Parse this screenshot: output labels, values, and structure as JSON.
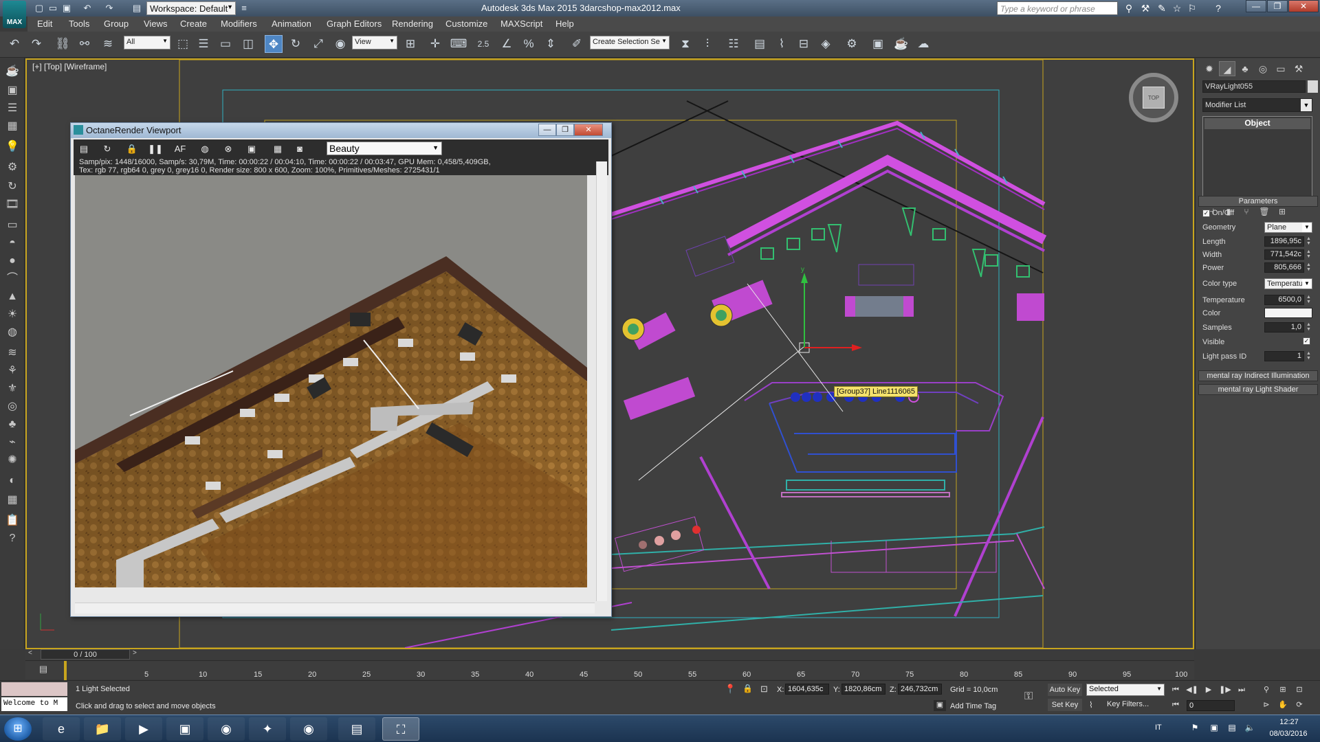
{
  "app": {
    "title": "Autodesk 3ds Max 2015    3darcshop-max2012.max",
    "logo_text": "MAX",
    "workspace": "Workspace: Default",
    "search_placeholder": "Type a keyword or phrase"
  },
  "menu": [
    "Edit",
    "Tools",
    "Group",
    "Views",
    "Create",
    "Modifiers",
    "Animation",
    "Graph Editors",
    "Rendering",
    "Customize",
    "MAXScript",
    "Help"
  ],
  "toolbar": {
    "selection_filter": "All",
    "ref_coord": "View",
    "snap_value": "2.5",
    "named_selection": "Create Selection Se"
  },
  "viewport": {
    "label": "[+] [Top] [Wireframe]",
    "tooltip": "[Group37] Line1116065",
    "viewcube_label": "TOP"
  },
  "octane": {
    "title": "OctaneRender Viewport",
    "pass": "Beauty",
    "stats_line1": "Samp/pix: 1448/16000,   Samp/s: 30,79M,   Time: 00:00:22 / 00:04:10,   Time: 00:00:22 / 00:03:47,   GPU Mem: 0,458/5,409GB,",
    "stats_line2": "Tex: rgb 77, rgb64 0, grey 0, grey16 0,   Render size: 800 x 600,   Zoom: 100%,   Primitives/Meshes: 2725431/1"
  },
  "command_panel": {
    "object_name": "VRayLight055",
    "modifier_list": "Modifier List",
    "stack_item": "Object",
    "parameters_header": "Parameters",
    "on_off_label": "On/Off",
    "on_off_checked": true,
    "params": [
      {
        "label": "Geometry",
        "type": "dropdown",
        "value": "Plane"
      },
      {
        "label": "Length",
        "type": "spinner",
        "value": "1896,95c"
      },
      {
        "label": "Width",
        "type": "spinner",
        "value": "771,542c"
      },
      {
        "label": "Power",
        "type": "spinner",
        "value": "805,666"
      },
      {
        "label": "Color type",
        "type": "dropdown",
        "value": "Temperature"
      },
      {
        "label": "Temperature",
        "type": "spinner",
        "value": "6500,0"
      },
      {
        "label": "Color",
        "type": "color",
        "value": "#f5f5f5"
      },
      {
        "label": "Samples",
        "type": "spinner",
        "value": "1,0"
      },
      {
        "label": "Visible",
        "type": "checkbox",
        "value": "✓"
      },
      {
        "label": "Light pass ID",
        "type": "spinner",
        "value": "1"
      }
    ],
    "rollout_mr_gi": "mental ray Indirect Illumination",
    "rollout_mr_shader": "mental ray Light Shader"
  },
  "timeline": {
    "slider": "0 / 100",
    "ticks": [
      "5",
      "10",
      "15",
      "20",
      "25",
      "30",
      "35",
      "40",
      "45",
      "50",
      "55",
      "60",
      "65",
      "70",
      "75",
      "80",
      "85",
      "90",
      "95",
      "100"
    ]
  },
  "status": {
    "maxscript_text": "Welcome to M",
    "selection": "1 Light Selected",
    "prompt": "Click and drag to select and move objects",
    "x_label": "X:",
    "x": "1604,635c",
    "y_label": "Y:",
    "y": "1820,86cm",
    "z_label": "Z:",
    "z": "246,732cm",
    "grid": "Grid = 10,0cm",
    "add_time_tag": "Add Time Tag",
    "auto_key": "Auto Key",
    "set_key": "Set Key",
    "key_mode": "Selected",
    "key_filters": "Key Filters...",
    "frame": "0"
  },
  "taskbar": {
    "lang": "IT",
    "time": "12:27",
    "date": "08/03/2016"
  }
}
